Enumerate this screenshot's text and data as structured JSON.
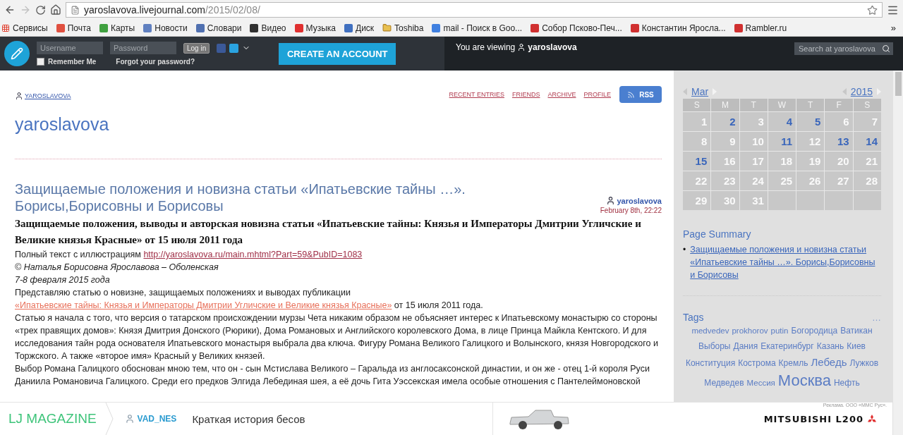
{
  "browser": {
    "url_host": "yaroslavova.livejournal.com",
    "url_path": "/2015/02/08/",
    "back_disabled": false,
    "forward_disabled": true,
    "bookmarks": [
      {
        "label": "Сервисы",
        "kind": "apps",
        "color": "#e04030"
      },
      {
        "label": "Почта",
        "kind": "site",
        "color": "#e05040"
      },
      {
        "label": "Карты",
        "kind": "site",
        "color": "#40a040"
      },
      {
        "label": "Новости",
        "kind": "site",
        "color": "#6080c0"
      },
      {
        "label": "Словари",
        "kind": "site",
        "color": "#5070b0"
      },
      {
        "label": "Видео",
        "kind": "site",
        "color": "#303030"
      },
      {
        "label": "Музыка",
        "kind": "site",
        "color": "#e03030"
      },
      {
        "label": "Диск",
        "kind": "site",
        "color": "#4070c0"
      },
      {
        "label": "Toshiba",
        "kind": "folder",
        "color": "#e8c050"
      },
      {
        "label": "mail - Поиск в Goo...",
        "kind": "site",
        "color": "#4080e0"
      },
      {
        "label": "Собор Псково-Печ...",
        "kind": "site",
        "color": "#d03030"
      },
      {
        "label": "Константин Яросла...",
        "kind": "site",
        "color": "#d03030"
      },
      {
        "label": "Rambler.ru",
        "kind": "site",
        "color": "#d03030"
      }
    ],
    "more": "»"
  },
  "lj_header": {
    "username_placeholder": "Username",
    "password_placeholder": "Password",
    "login": "Log in",
    "remember_me": "Remember Me",
    "remember_checked": false,
    "forgot": "Forgot your password?",
    "create": "CREATE AN ACCOUNT",
    "viewing": "You are viewing",
    "viewing_user": "yaroslavova",
    "search_placeholder": "Search at yaroslavova"
  },
  "journal": {
    "user": "YAROSLAVOVA",
    "nav": [
      "RECENT ENTRIES",
      "FRIENDS",
      "ARCHIVE",
      "PROFILE"
    ],
    "rss": "RSS",
    "title": "yaroslavova"
  },
  "entry": {
    "title": "Защищаемые положения и новизна статьи «Ипатьевские тайны …». Борисы,Борисовны и Борисовы",
    "author": "yaroslavova",
    "date": "February 8th, 22:22",
    "paragraphs": [
      {
        "kind": "heading",
        "text": "Защищаемые положения, выводы и авторская новизна статьи «Ипатьевские тайны: Князья и Императоры Дмитрии Угличские и Великие князья Красные» от 15 июля 2011 года"
      },
      {
        "kind": "text",
        "text": "Полный  текст с иллюстрациям ",
        "link": "http://yaroslavova.ru/main.mhtml?Part=59&PubID=1083",
        "visited": true
      },
      {
        "kind": "italic",
        "text": "© Наталья Борисовна Ярославова – Оболенская"
      },
      {
        "kind": "italic",
        "text": "7-8 февраля 2015 года"
      },
      {
        "kind": "text",
        "text": "Представляю статью о новизне, защищаемых положениях и выводах публикации ",
        "link": "«Ипатьевские тайны: Князья и Императоры Дмитрии Угличские и Великие князья Красные»",
        "visited": false,
        "after": " от 15 июля 2011 года."
      },
      {
        "kind": "text",
        "text": "Статью я начала с того, что версия о татарском происхождении мурзы Чета никаким образом не объясняет интерес к Ипатьевскому монастырю со стороны «трех правящих домов»: Князя Дмитрия Донского (Рюрики), Дома Романовых и Английского королевского Дома, в лице Принца Майкла Кентского. И для исследования тайн рода основателя Ипатьевского монастыря выбрала два ключа. Фигуру Романа Великого Галицкого и Волынского, князя Новгородского и Торжского. А также «второе имя» Красный у Великих князей."
      },
      {
        "kind": "text",
        "text": "Выбор Романа Галицкого обоснован мною тем, что он - сын Мстислава Великого – Гаральда из англосаксонской династии, и он же - отец 1-й короля Руси Даниила Романовича Галицкого. Среди его предков Элгида Лебединая шея, а её дочь Гита Уэссекская имела особые отношения с Пантелеймоновской"
      }
    ]
  },
  "calendar": {
    "month": "Mar",
    "year": "2015",
    "weekdays": [
      "S",
      "M",
      "T",
      "W",
      "T",
      "F",
      "S"
    ],
    "weeks": [
      [
        {
          "day": "1",
          "linked": false
        },
        {
          "day": "2",
          "linked": true
        },
        {
          "day": "3",
          "linked": false
        },
        {
          "day": "4",
          "linked": true
        },
        {
          "day": "5",
          "linked": true
        },
        {
          "day": "6",
          "linked": false
        },
        {
          "day": "7",
          "linked": false
        }
      ],
      [
        {
          "day": "8",
          "linked": false
        },
        {
          "day": "9",
          "linked": false
        },
        {
          "day": "10",
          "linked": false
        },
        {
          "day": "11",
          "linked": true
        },
        {
          "day": "12",
          "linked": false
        },
        {
          "day": "13",
          "linked": true
        },
        {
          "day": "14",
          "linked": true
        }
      ],
      [
        {
          "day": "15",
          "linked": true
        },
        {
          "day": "16",
          "linked": false
        },
        {
          "day": "17",
          "linked": false
        },
        {
          "day": "18",
          "linked": false
        },
        {
          "day": "19",
          "linked": false
        },
        {
          "day": "20",
          "linked": false
        },
        {
          "day": "21",
          "linked": false
        }
      ],
      [
        {
          "day": "22",
          "linked": false
        },
        {
          "day": "23",
          "linked": false
        },
        {
          "day": "24",
          "linked": false
        },
        {
          "day": "25",
          "linked": false
        },
        {
          "day": "26",
          "linked": false
        },
        {
          "day": "27",
          "linked": false
        },
        {
          "day": "28",
          "linked": false
        }
      ],
      [
        {
          "day": "29",
          "linked": false
        },
        {
          "day": "30",
          "linked": false
        },
        {
          "day": "31",
          "linked": false
        }
      ]
    ]
  },
  "page_summary": {
    "title": "Page Summary",
    "bullet": "•",
    "items": [
      "Защищаемые положения и новизна статьи «Ипатьевские тайны …». Борисы,Борисовны и Борисовы"
    ]
  },
  "tags": {
    "title": "Tags",
    "more": "…",
    "items": [
      {
        "label": "medvedev",
        "kind": "small"
      },
      {
        "label": "prokhorov",
        "kind": "small"
      },
      {
        "label": "putin",
        "kind": "small"
      },
      {
        "label": "Богородица",
        "kind": "normal"
      },
      {
        "label": "Ватикан",
        "kind": "normal"
      },
      {
        "label": "Выборы",
        "kind": "normal"
      },
      {
        "label": "Дания",
        "kind": "normal"
      },
      {
        "label": "Екатеринбург",
        "kind": "normal"
      },
      {
        "label": "Казань",
        "kind": "normal"
      },
      {
        "label": "Киев",
        "kind": "normal"
      },
      {
        "label": "Конституция",
        "kind": "normal"
      },
      {
        "label": "Кострома",
        "kind": "normal"
      },
      {
        "label": "Кремль",
        "kind": "normal"
      },
      {
        "label": "Лебедь",
        "kind": "large"
      },
      {
        "label": "Лужков",
        "kind": "normal"
      },
      {
        "label": "Медведев",
        "kind": "normal"
      },
      {
        "label": "Мессия",
        "kind": "small"
      },
      {
        "label": "Москва",
        "kind": "huge"
      },
      {
        "label": "Нефть",
        "kind": "normal"
      }
    ]
  },
  "bottom_bar": {
    "brand": "LJ MAGAZINE",
    "author": "VAD_NES",
    "headline": "Краткая история бесов",
    "ad_note": "Реклама. ООО «ММС Рус».",
    "ad_brand": "MITSUBISHI L200"
  }
}
